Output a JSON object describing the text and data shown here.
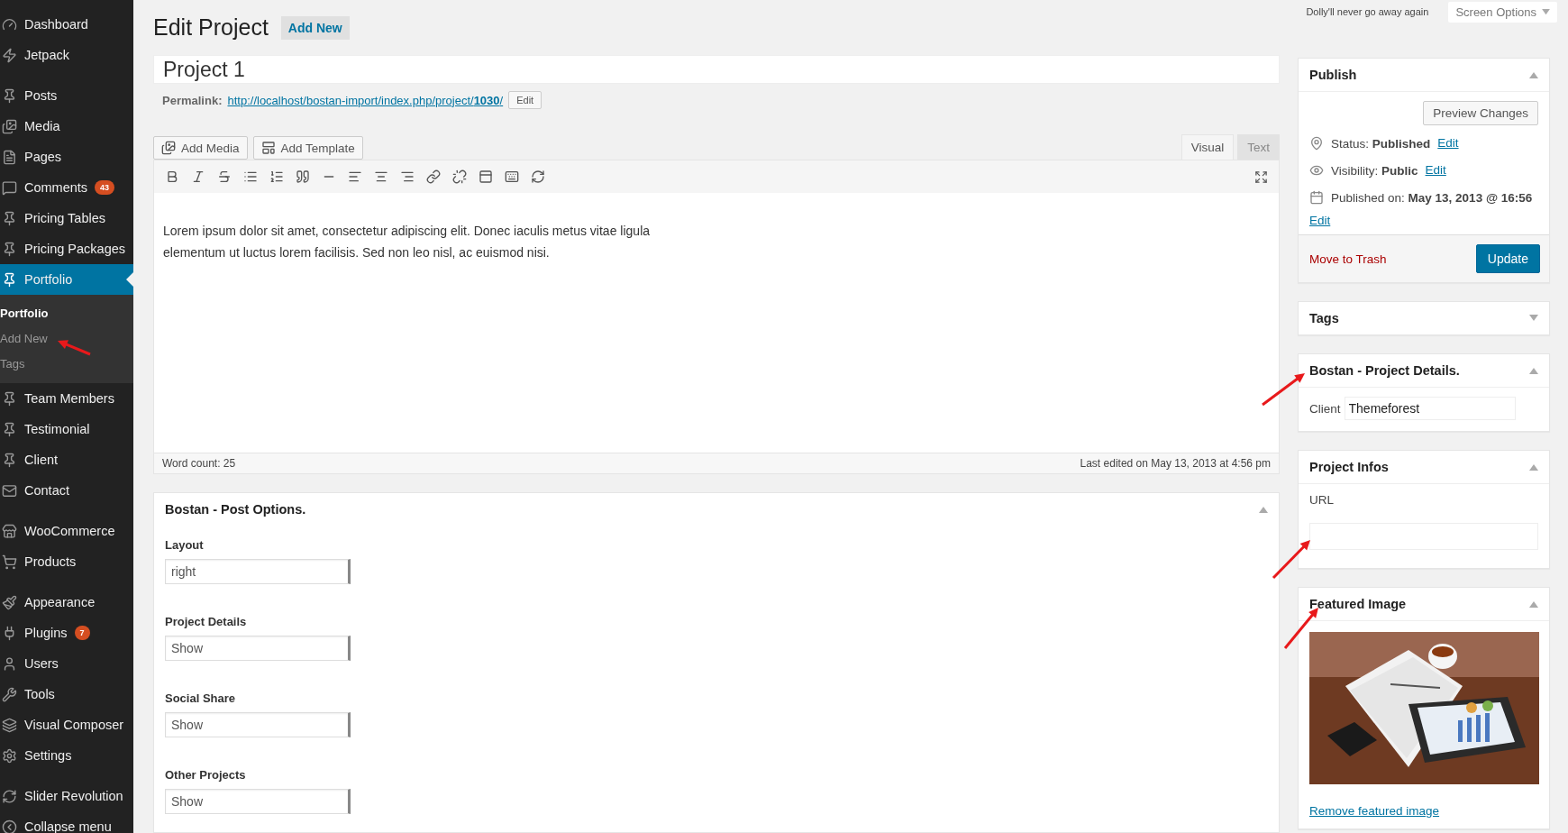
{
  "menu_groups": [
    [
      {
        "label": "Dashboard",
        "selected": false
      },
      {
        "label": "Jetpack",
        "selected": false
      }
    ],
    [
      {
        "label": "Posts",
        "selected": false
      },
      {
        "label": "Media",
        "selected": false
      },
      {
        "label": "Pages",
        "selected": false
      },
      {
        "label": "Comments",
        "selected": false,
        "badge": "43"
      },
      {
        "label": "Pricing Tables",
        "selected": false
      },
      {
        "label": "Pricing Packages",
        "selected": false
      },
      {
        "label": "Portfolio",
        "selected": true,
        "children": [
          {
            "label": "Portfolio",
            "selected": true
          },
          {
            "label": "Add New",
            "selected": false
          },
          {
            "label": "Tags",
            "selected": false
          }
        ]
      },
      {
        "label": "Team Members",
        "selected": false
      },
      {
        "label": "Testimonial",
        "selected": false
      },
      {
        "label": "Client",
        "selected": false
      },
      {
        "label": "Contact",
        "selected": false
      }
    ],
    [
      {
        "label": "WooCommerce",
        "selected": false
      },
      {
        "label": "Products",
        "selected": false
      }
    ],
    [
      {
        "label": "Appearance",
        "selected": false
      },
      {
        "label": "Plugins",
        "selected": false,
        "badge": "7"
      },
      {
        "label": "Users",
        "selected": false
      },
      {
        "label": "Tools",
        "selected": false
      },
      {
        "label": "Visual Composer",
        "selected": false
      },
      {
        "label": "Settings",
        "selected": false
      }
    ],
    [
      {
        "label": "Slider Revolution",
        "selected": false
      },
      {
        "label": "Collapse menu",
        "selected": false
      }
    ]
  ],
  "top_bar": {
    "notice": "Dolly'll never go away again",
    "screen_options": "Screen Options"
  },
  "heading": {
    "title": "Edit Project",
    "add_new": "Add New"
  },
  "post_title": {
    "value": "Project 1"
  },
  "permalink": {
    "label": "Permalink:",
    "url": "http://localhost/bostan-import/index.php/project/**1030**/",
    "edit": "Edit"
  },
  "media_buttons": [
    "Add Media",
    "Add Template"
  ],
  "editor_tabs": [
    {
      "label": "Visual",
      "selected": true
    },
    {
      "label": "Text",
      "selected": false
    }
  ],
  "editor": {
    "content": "Lorem ipsum dolor sit amet, consectetur adipiscing elit. Donec iaculis metus vitae ligula elementum ut luctus lorem facilisis. Sed non leo nisl, ac euismod nisi.",
    "word_count": "Word count: 25",
    "last_edited": "Last edited on May 13, 2013 at 4:56 pm"
  },
  "post_options": {
    "title": "Bostan - Post Options.",
    "expanded": true,
    "fields": [
      {
        "label": "Layout",
        "value": "right"
      },
      {
        "label": "Project Details",
        "value": "Show"
      },
      {
        "label": "Social Share",
        "value": "Show"
      },
      {
        "label": "Other Projects",
        "value": "Show"
      }
    ]
  },
  "publish": {
    "title": "Publish",
    "expanded": true,
    "preview": "Preview Changes",
    "rows": [
      {
        "label": "Status:",
        "value": "Published",
        "edit": "Edit"
      },
      {
        "label": "Visibility:",
        "value": "Public",
        "edit": "Edit"
      },
      {
        "label": "Published on:",
        "value": "May 13, 2013 @ 16:56",
        "edit": "Edit"
      }
    ],
    "trash": "Move to Trash",
    "update": "Update"
  },
  "tags_box": {
    "title": "Tags",
    "expanded": false
  },
  "project_details": {
    "title": "Bostan - Project Details.",
    "expanded": true,
    "label": "Client",
    "value": "Themeforest"
  },
  "project_infos": {
    "title": "Project Infos",
    "expanded": true,
    "label": "URL"
  },
  "featured_image": {
    "title": "Featured Image",
    "expanded": true,
    "remove": "Remove featured image"
  }
}
